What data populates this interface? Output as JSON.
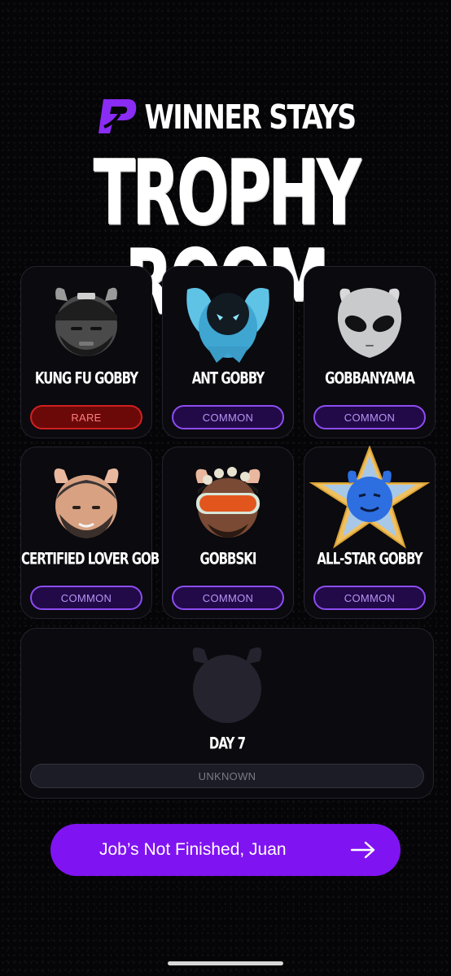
{
  "brand": {
    "name": "WINNER STAYS",
    "logo_icon": "p-logo-icon",
    "accent": "#8013f2"
  },
  "page": {
    "title": "TROPHY ROOM"
  },
  "trophies": [
    {
      "name": "KUNG FU GOBBY",
      "rarity": "RARE",
      "icon": "kung-fu-gobby-avatar"
    },
    {
      "name": "ANT GOBBY",
      "rarity": "COMMON",
      "icon": "ant-gobby-avatar"
    },
    {
      "name": "GOBBANYAMA",
      "rarity": "COMMON",
      "icon": "gobbanyama-avatar"
    },
    {
      "name": "CERTIFIED LOVER GOB",
      "rarity": "COMMON",
      "icon": "certified-lover-gob-avatar"
    },
    {
      "name": "GOBBSKI",
      "rarity": "COMMON",
      "icon": "gobbski-avatar"
    },
    {
      "name": "ALL-STAR GOBBY",
      "rarity": "COMMON",
      "icon": "all-star-gobby-avatar"
    }
  ],
  "locked": {
    "name": "DAY 7",
    "rarity": "UNKNOWN",
    "icon": "locked-silhouette-icon"
  },
  "cta": {
    "label": "Job’s Not Finished, Juan",
    "icon": "arrow-right-icon"
  },
  "colors": {
    "common_border": "#8d4cf0",
    "rare_border": "#d12020",
    "unknown_bg": "#1c1c26"
  }
}
